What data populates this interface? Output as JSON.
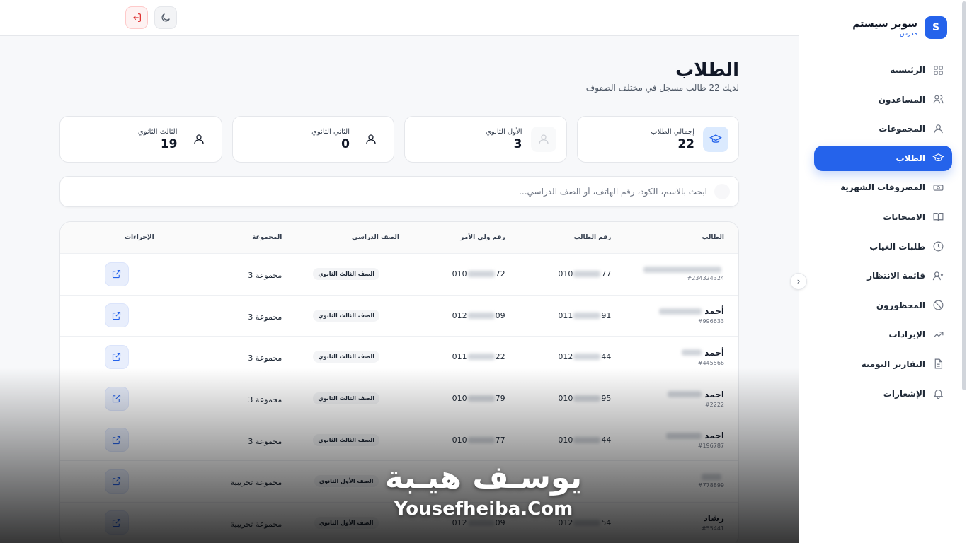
{
  "brand": {
    "initial": "S",
    "name": "سوبر سيستم",
    "role": "مدرس"
  },
  "nav": [
    {
      "label": "الرئيسية",
      "icon": "grid-icon",
      "active": false
    },
    {
      "label": "المساعدون",
      "icon": "users-icon",
      "active": false
    },
    {
      "label": "المجموعات",
      "icon": "user-group-icon",
      "active": false
    },
    {
      "label": "الطلاب",
      "icon": "graduation-cap-icon",
      "active": true
    },
    {
      "label": "المصروفات الشهرية",
      "icon": "cash-icon",
      "active": false
    },
    {
      "label": "الامتحانات",
      "icon": "book-open-icon",
      "active": false
    },
    {
      "label": "طلبات الغياب",
      "icon": "clock-icon",
      "active": false
    },
    {
      "label": "قائمة الانتظار",
      "icon": "user-x-icon",
      "active": false
    },
    {
      "label": "المحظورون",
      "icon": "ban-icon",
      "active": false
    },
    {
      "label": "الإيرادات",
      "icon": "trending-up-icon",
      "active": false
    },
    {
      "label": "التقارير اليومية",
      "icon": "document-icon",
      "active": false
    },
    {
      "label": "الإشعارات",
      "icon": "bell-icon",
      "active": false
    }
  ],
  "page": {
    "title": "الطلاب",
    "subtitle": "لديك 22 طالب مسجل في مختلف الصفوف"
  },
  "stats": [
    {
      "label": "إجمالي الطلاب",
      "value": "22",
      "icon": "graduation-cap-icon"
    },
    {
      "label": "الأول الثانوي",
      "value": "3",
      "icon": "user-icon"
    },
    {
      "label": "الثاني الثانوي",
      "value": "0",
      "icon": "user-icon"
    },
    {
      "label": "الثالث الثانوي",
      "value": "19",
      "icon": "user-icon"
    }
  ],
  "search": {
    "placeholder": "ابحث بالاسم، الكود، رقم الهاتف، أو الصف الدراسي..."
  },
  "table": {
    "headers": {
      "student": "الطالب",
      "student_phone": "رقم الطالب",
      "parent_phone": "رقم ولي الأمر",
      "grade": "الصف الدراسي",
      "group": "المجموعة",
      "actions": "الإجراءات"
    },
    "rows": [
      {
        "name": "",
        "code": "#234324324",
        "phone_start": "010",
        "phone_end": "77",
        "parent_start": "010",
        "parent_end": "72",
        "grade": "الصف الثالث الثانوي",
        "group": "مجموعة 3"
      },
      {
        "name": "أحمد",
        "code": "#996633",
        "phone_start": "011",
        "phone_end": "91",
        "parent_start": "012",
        "parent_end": "09",
        "grade": "الصف الثالث الثانوي",
        "group": "مجموعة 3"
      },
      {
        "name": "أحمد",
        "code": "#445566",
        "phone_start": "012",
        "phone_end": "44",
        "parent_start": "011",
        "parent_end": "22",
        "grade": "الصف الثالث الثانوي",
        "group": "مجموعة 3"
      },
      {
        "name": "احمد",
        "code": "#2222",
        "phone_start": "010",
        "phone_end": "95",
        "parent_start": "010",
        "parent_end": "79",
        "grade": "الصف الثالث الثانوي",
        "group": "مجموعة 3"
      },
      {
        "name": "احمد",
        "code": "#196787",
        "phone_start": "010",
        "phone_end": "44",
        "parent_start": "010",
        "parent_end": "77",
        "grade": "الصف الثالث الثانوي",
        "group": "مجموعة 3"
      },
      {
        "name": "",
        "code": "#778899",
        "phone_start": "",
        "phone_end": "",
        "parent_start": "",
        "parent_end": "",
        "grade": "الصف الأول الثانوي",
        "group": "مجموعة تجريبية"
      },
      {
        "name": "رشاد",
        "code": "#55441",
        "phone_start": "012",
        "phone_end": "54",
        "parent_start": "012",
        "parent_end": "09",
        "grade": "الصف الأول الثانوي",
        "group": "مجموعة تجريبية"
      }
    ]
  },
  "watermark": {
    "arabic": "يوسـف هيـبة",
    "latin": "Yousefheiba.Com"
  },
  "colors": {
    "primary": "#2563eb",
    "danger": "#dc2626"
  }
}
